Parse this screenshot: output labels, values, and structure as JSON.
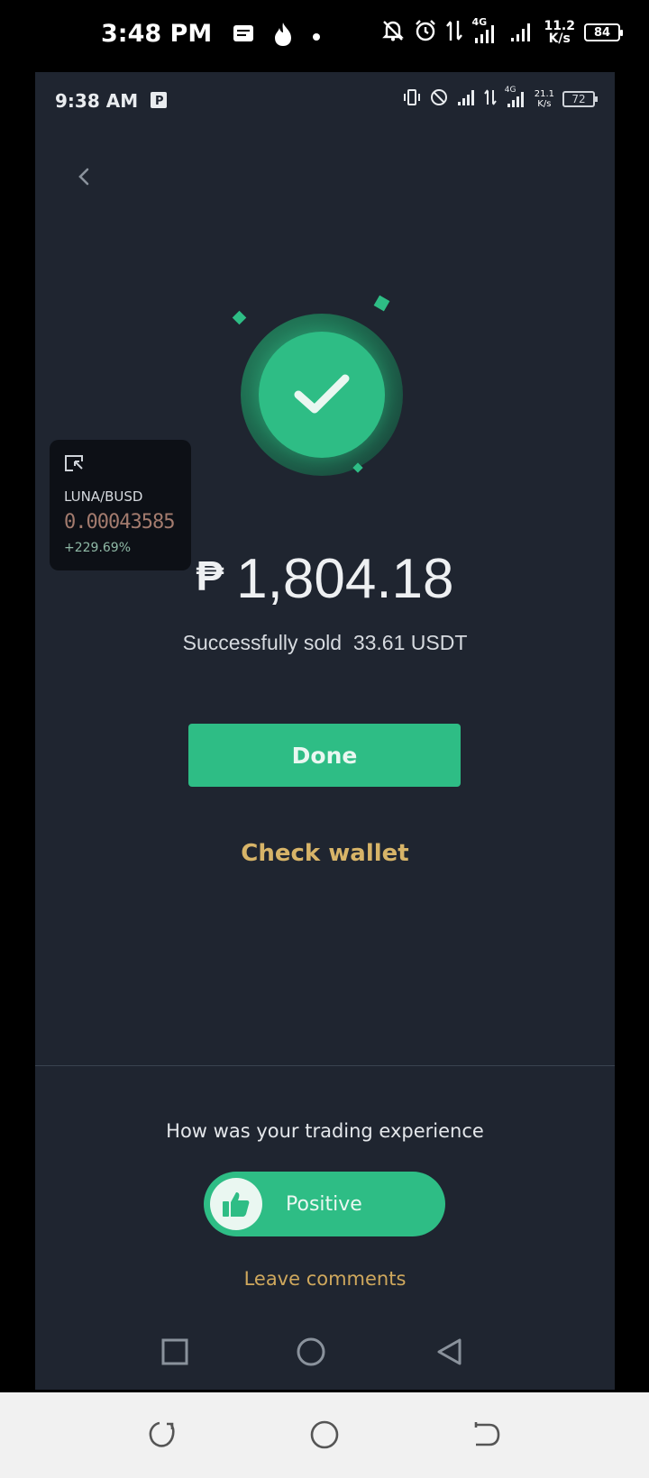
{
  "outer_status": {
    "time": "3:48 PM",
    "network_speed_value": "11.2",
    "network_speed_unit": "K/s",
    "network_type": "4G",
    "battery": "84",
    "icons": [
      "message-icon",
      "fire-icon",
      "dot-icon",
      "mute-bell-icon",
      "alarm-icon",
      "data-arrows-icon",
      "signal-icon",
      "signal-icon"
    ]
  },
  "inner_status": {
    "time": "9:38 AM",
    "network_speed_value": "21.1",
    "network_speed_unit": "K/s",
    "network_type": "4G",
    "battery": "72"
  },
  "ticker": {
    "pair": "LUNA/BUSD",
    "price": "0.00043585",
    "change": "+229.69%"
  },
  "result": {
    "currency_symbol": "₱",
    "amount": "1,804.18",
    "message": "Successfully sold  33.61 USDT"
  },
  "actions": {
    "done_label": "Done",
    "check_wallet_label": "Check wallet"
  },
  "feedback": {
    "question": "How was your trading experience",
    "positive_label": "Positive",
    "leave_comments_label": "Leave comments"
  },
  "colors": {
    "accent_green": "#2ebd85",
    "gold": "#d7b468",
    "background": "#1f2530"
  }
}
